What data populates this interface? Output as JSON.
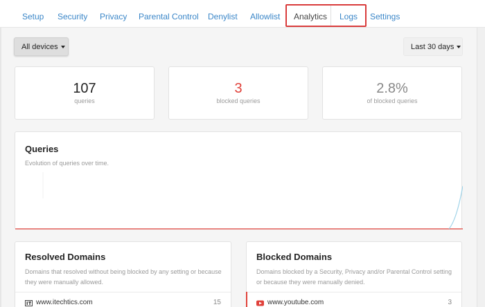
{
  "nav": {
    "tabs": [
      {
        "label": "Setup"
      },
      {
        "label": "Security"
      },
      {
        "label": "Privacy"
      },
      {
        "label": "Parental Control"
      },
      {
        "label": "Denylist"
      },
      {
        "label": "Allowlist"
      },
      {
        "label": "Analytics"
      },
      {
        "label": "Logs"
      },
      {
        "label": "Settings"
      }
    ],
    "active_tab": "Analytics",
    "highlight_color": "#d93a3a"
  },
  "filters": {
    "devices_label": "All devices",
    "period_label": "Last 30 days"
  },
  "stats": [
    {
      "value": "107",
      "label": "queries"
    },
    {
      "value": "3",
      "label": "blocked queries",
      "color": "#e0413a"
    },
    {
      "value": "2.8%",
      "label": "of blocked queries"
    }
  ],
  "queries_chart": {
    "title": "Queries",
    "subtitle": "Evolution of queries over time.",
    "line_color": "#9fd3e8",
    "blocked_color": "#e0413a"
  },
  "resolved_domains": {
    "title": "Resolved Domains",
    "description": "Domains that resolved without being blocked by any setting or because they were manually allowed.",
    "items": [
      {
        "domain": "www.itechtics.com",
        "count": "15",
        "icon": "itechtics-favicon-icon"
      }
    ]
  },
  "blocked_domains": {
    "title": "Blocked Domains",
    "description": "Domains blocked by a Security, Privacy and/or Parental Control setting or because they were manually denied.",
    "items": [
      {
        "domain": "www.youtube.com",
        "count": "3",
        "icon": "youtube-favicon-icon"
      }
    ]
  }
}
